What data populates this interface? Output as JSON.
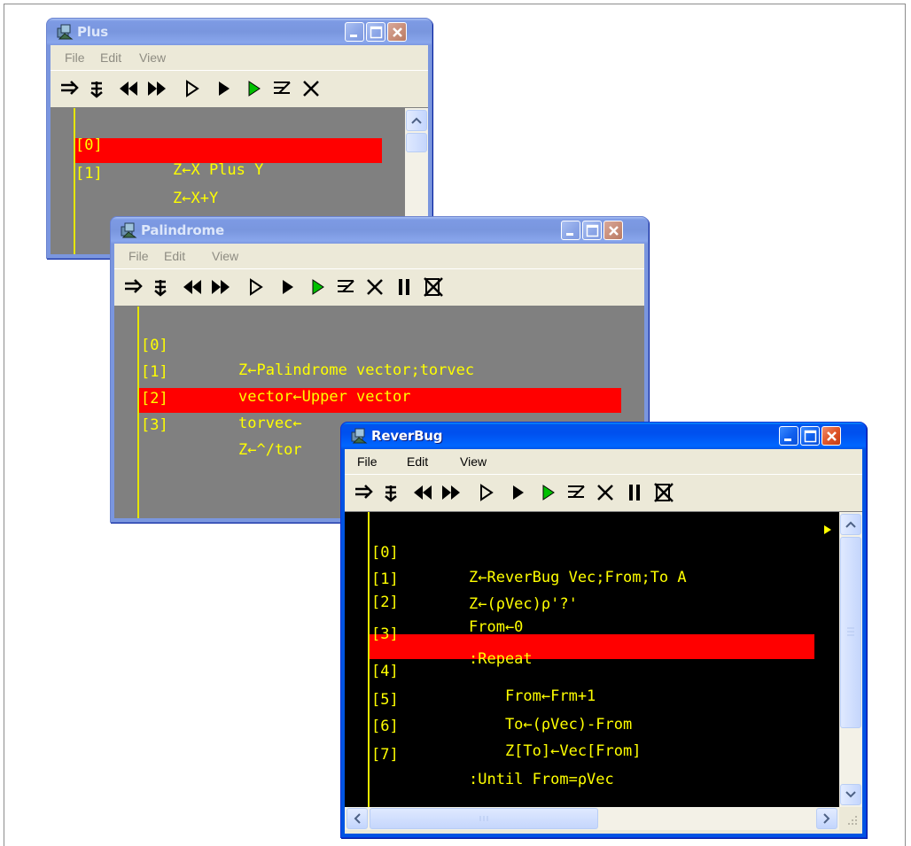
{
  "menu": {
    "file": "File",
    "edit": "Edit",
    "view": "View"
  },
  "toolbar_icons": [
    "execute-line-icon",
    "trace-into-icon",
    "backtrack-icon",
    "forward-skip-icon",
    "continue-icon",
    "run-icon",
    "restart-icon",
    "edit-icon",
    "quit-icon",
    "interrupt-icon",
    "clear-stops-icon"
  ],
  "windows": {
    "plus": {
      "title": "Plus",
      "lines": [
        {
          "num": "[0]",
          "text": "Z←X Plus Y"
        },
        {
          "num": "[1]",
          "text": "Z←X+Y"
        }
      ]
    },
    "palindrome": {
      "title": "Palindrome",
      "lines": [
        {
          "num": "[0]",
          "text": "Z←Palindrome vector;torvec"
        },
        {
          "num": "[1]",
          "text": "vector←Upper vector"
        },
        {
          "num": "[2]",
          "text": "torvec←"
        },
        {
          "num": "[3]",
          "text": "Z←^/tor"
        }
      ]
    },
    "reverbug": {
      "title": "ReverBug",
      "lines": [
        {
          "num": "[0]",
          "text": "Z←ReverBug Vec;From;To A"
        },
        {
          "num": "[1]",
          "text": "Z←(⍴Vec)⍴'?'"
        },
        {
          "num": "[2]",
          "text": "From←0"
        },
        {
          "num": "[3]",
          "text": ":Repeat"
        },
        {
          "num": "[4]",
          "text": "    From←Frm+1"
        },
        {
          "num": "[5]",
          "text": "    To←(⍴Vec)-From"
        },
        {
          "num": "[6]",
          "text": "    Z[To]←Vec[From]"
        },
        {
          "num": "[7]",
          "text": ":Until From=⍴Vec"
        }
      ]
    }
  },
  "colors": {
    "code_text": "#ffff00",
    "highlight": "#ff0000",
    "active_title": "#0054e3",
    "inactive_title": "#7a96df"
  }
}
